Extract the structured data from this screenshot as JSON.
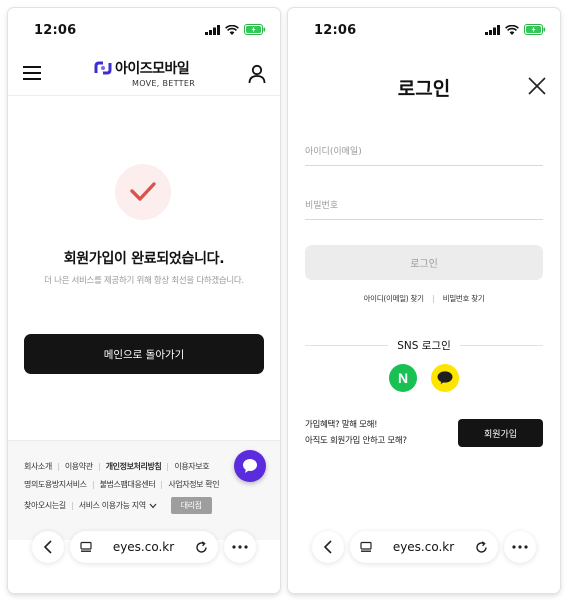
{
  "left_screen": {
    "status": {
      "time": "12:06"
    },
    "header": {
      "logo_text": "아이즈모바일",
      "logo_tagline": "MOVE, BETTER"
    },
    "result": {
      "title": "회원가입이 완료되었습니다.",
      "subtitle": "더 나은 서비스를 제공하기 위해 항상 최선을 다하겠습니다.",
      "main_button": "메인으로 돌아가기"
    },
    "footer": {
      "row1": [
        "회사소개",
        "이용약관",
        "개인정보처리방침",
        "이용자보호"
      ],
      "row2": [
        "명의도용방지서비스",
        "불법스팸대응센터",
        "사업자정보 확인"
      ],
      "row3": [
        "찾아오시는길",
        "서비스 이용가능 지역"
      ],
      "dealer_button": "대리점"
    },
    "browser": {
      "url": "eyes.co.kr"
    }
  },
  "right_screen": {
    "status": {
      "time": "12:06"
    },
    "title": "로그인",
    "id_placeholder": "아이디(이메일)",
    "pw_placeholder": "비밀번호",
    "login_button": "로그인",
    "find_id": "아이디(이메일) 찾기",
    "find_pw": "비밀번호 찾기",
    "sns_label": "SNS 로그인",
    "naver_letter": "N",
    "promo_line1": "가입혜택? 말해 모해!",
    "promo_line2": "아직도 회원가입 안하고 모해?",
    "join_button": "회원가입",
    "browser": {
      "url": "eyes.co.kr"
    }
  },
  "colors": {
    "brand_purple": "#5b2bde",
    "logo_blue": "#3b2fd1",
    "check_red": "#d9534f",
    "naver_green": "#19c153",
    "kakao_yellow": "#fee500"
  },
  "icons": [
    "signal-icon",
    "wifi-icon",
    "battery-icon",
    "menu-icon",
    "user-icon",
    "check-icon",
    "chat-icon",
    "back-icon",
    "tabs-icon",
    "reload-icon",
    "more-icon",
    "close-icon",
    "chevron-down-icon",
    "kakao-icon"
  ]
}
